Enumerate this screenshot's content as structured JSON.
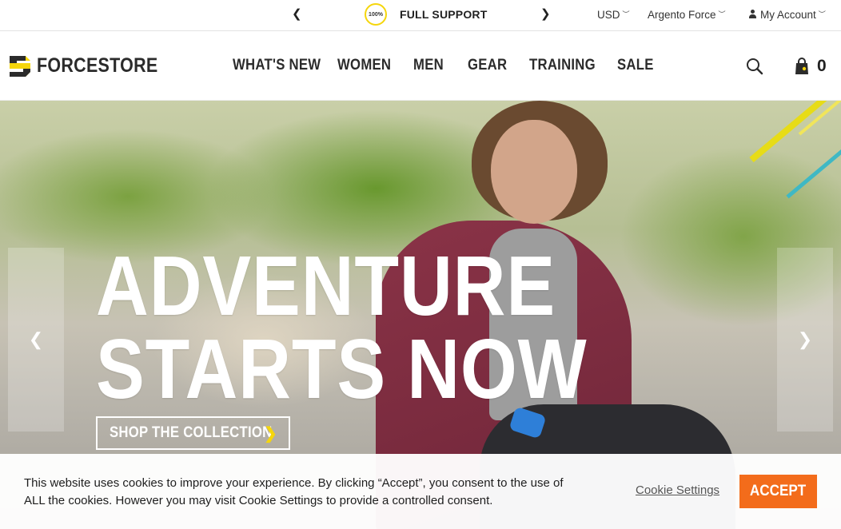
{
  "topbar": {
    "prev_arrow": "❮",
    "next_arrow": "❯",
    "support_badge": "100%",
    "support_text": "FULL SUPPORT",
    "currency": "USD",
    "store": "Argento Force",
    "account": "My Account"
  },
  "header": {
    "logo_text": "FORCESTORE",
    "nav": [
      "WHAT'S NEW",
      "WOMEN",
      "MEN",
      "GEAR",
      "TRAINING",
      "SALE"
    ],
    "cart_count": "0",
    "icons": {
      "search": "search-icon",
      "cart": "cart-icon",
      "account": "user-icon"
    }
  },
  "hero": {
    "title_line1": "ADVENTURE",
    "title_line2": "STARTS NOW",
    "cta_label": "SHOP THE COLLECTION",
    "cta_arrow": "❯",
    "prev_arrow": "❮",
    "next_arrow": "❯"
  },
  "cookie": {
    "text": "This website uses cookies to improve your experience. By clicking “Accept”, you consent to the use of ALL the cookies. However you may visit Cookie Settings to provide a controlled consent.",
    "settings_label": "Cookie Settings",
    "accept_label": "ACCEPT"
  },
  "colors": {
    "accent_yellow": "#f5d60c",
    "accept_orange": "#f36c1b",
    "logo_dark": "#2b2b2b"
  }
}
